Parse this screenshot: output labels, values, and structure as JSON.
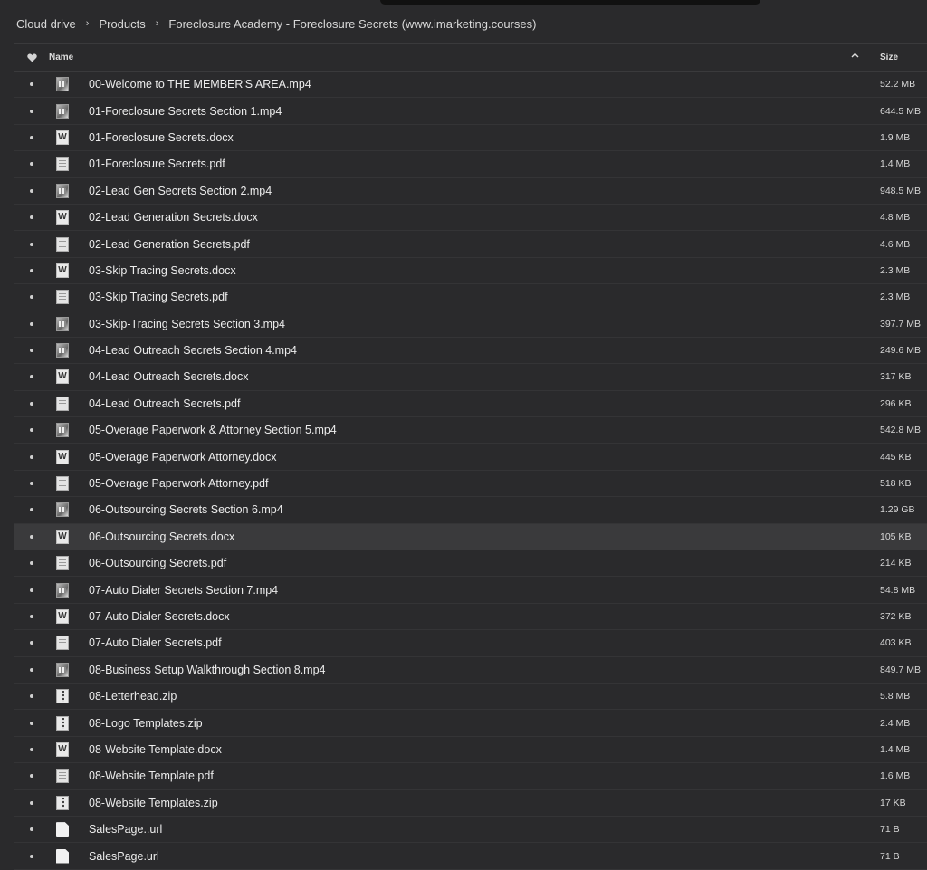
{
  "breadcrumb": [
    "Cloud drive",
    "Products",
    "Foreclosure Academy - Foreclosure Secrets (www.imarketing.courses)"
  ],
  "separator": "›",
  "header": {
    "name": "Name",
    "size": "Size",
    "favorite_icon": "heart-icon",
    "sort": "ascending"
  },
  "files": [
    {
      "name": "00-Welcome to THE MEMBER'S AREA.mp4",
      "size": "52.2 MB",
      "icon": "video"
    },
    {
      "name": "01-Foreclosure Secrets Section 1.mp4",
      "size": "644.5 MB",
      "icon": "video"
    },
    {
      "name": "01-Foreclosure Secrets.docx",
      "size": "1.9 MB",
      "icon": "word"
    },
    {
      "name": "01-Foreclosure Secrets.pdf",
      "size": "1.4 MB",
      "icon": "pdf"
    },
    {
      "name": "02-Lead Gen Secrets Section 2.mp4",
      "size": "948.5 MB",
      "icon": "video"
    },
    {
      "name": "02-Lead Generation Secrets.docx",
      "size": "4.8 MB",
      "icon": "word"
    },
    {
      "name": "02-Lead Generation Secrets.pdf",
      "size": "4.6 MB",
      "icon": "pdf"
    },
    {
      "name": "03-Skip Tracing Secrets.docx",
      "size": "2.3 MB",
      "icon": "word"
    },
    {
      "name": "03-Skip Tracing Secrets.pdf",
      "size": "2.3 MB",
      "icon": "pdf"
    },
    {
      "name": "03-Skip-Tracing Secrets Section 3.mp4",
      "size": "397.7 MB",
      "icon": "video"
    },
    {
      "name": "04-Lead Outreach Secrets Section 4.mp4",
      "size": "249.6 MB",
      "icon": "video"
    },
    {
      "name": "04-Lead Outreach Secrets.docx",
      "size": "317 KB",
      "icon": "word"
    },
    {
      "name": "04-Lead Outreach Secrets.pdf",
      "size": "296 KB",
      "icon": "pdf"
    },
    {
      "name": "05-Overage Paperwork & Attorney Section 5.mp4",
      "size": "542.8 MB",
      "icon": "video"
    },
    {
      "name": "05-Overage Paperwork Attorney.docx",
      "size": "445 KB",
      "icon": "word"
    },
    {
      "name": "05-Overage Paperwork Attorney.pdf",
      "size": "518 KB",
      "icon": "pdf"
    },
    {
      "name": "06-Outsourcing Secrets Section 6.mp4",
      "size": "1.29 GB",
      "icon": "video"
    },
    {
      "name": "06-Outsourcing Secrets.docx",
      "size": "105 KB",
      "icon": "word",
      "selected": true
    },
    {
      "name": "06-Outsourcing Secrets.pdf",
      "size": "214 KB",
      "icon": "pdf"
    },
    {
      "name": "07-Auto Dialer Secrets Section 7.mp4",
      "size": "54.8 MB",
      "icon": "video"
    },
    {
      "name": "07-Auto Dialer Secrets.docx",
      "size": "372 KB",
      "icon": "word"
    },
    {
      "name": "07-Auto Dialer Secrets.pdf",
      "size": "403 KB",
      "icon": "pdf"
    },
    {
      "name": "08-Business Setup Walkthrough Section 8.mp4",
      "size": "849.7 MB",
      "icon": "video"
    },
    {
      "name": "08-Letterhead.zip",
      "size": "5.8 MB",
      "icon": "zip"
    },
    {
      "name": "08-Logo Templates.zip",
      "size": "2.4 MB",
      "icon": "zip"
    },
    {
      "name": "08-Website Template.docx",
      "size": "1.4 MB",
      "icon": "word"
    },
    {
      "name": "08-Website Template.pdf",
      "size": "1.6 MB",
      "icon": "pdf"
    },
    {
      "name": "08-Website Templates.zip",
      "size": "17 KB",
      "icon": "zip"
    },
    {
      "name": "SalesPage..url",
      "size": "71 B",
      "icon": "url"
    },
    {
      "name": "SalesPage.url",
      "size": "71 B",
      "icon": "url"
    }
  ]
}
